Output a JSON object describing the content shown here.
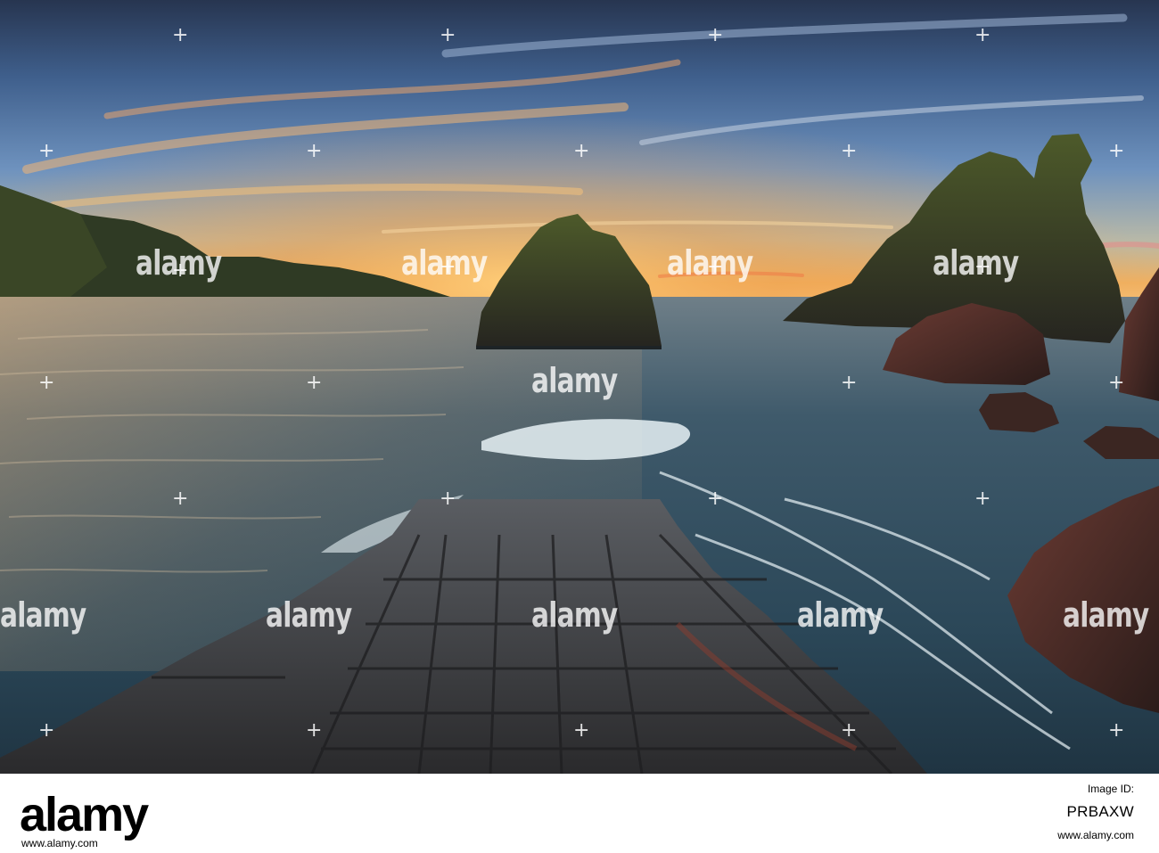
{
  "photo": {
    "watermark_text": "alamy",
    "watermark_symbol": "+"
  },
  "footer": {
    "brand": "alamy",
    "image_id_label": "Image ID:",
    "image_id": "PRBAXW",
    "website": "www.alamy.com"
  },
  "colors": {
    "sky_top": "#2c3d5a",
    "sky_mid": "#5f86b6",
    "horizon_glow": "#f3a24a",
    "sea": "#2f4d5f",
    "rock": "#2b2b26",
    "moss": "#5a6a2a",
    "slipway": "#3b3b3d"
  }
}
